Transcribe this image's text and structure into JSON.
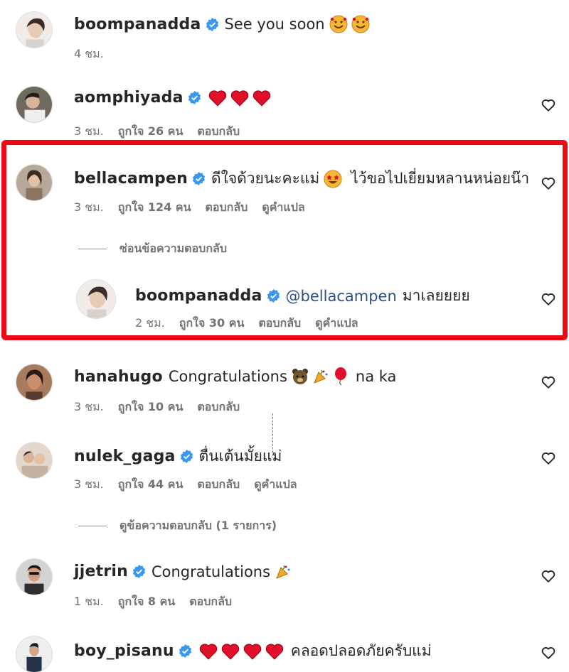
{
  "colors": {
    "highlight": "#ee0a14",
    "verified": "#3897f0",
    "heart_emoji": "#e0102a",
    "meta": "#737373",
    "mention": "#2b4f91"
  },
  "comments": [
    {
      "username": "boompanadda",
      "verified": true,
      "text": "See you soon",
      "emojis": [
        "smiling-face-with-hearts",
        "smiling-face-with-hearts"
      ],
      "time": "4 ชม.",
      "likes": "",
      "reply": "",
      "translate": "",
      "has_heart": false
    },
    {
      "username": "aomphiyada",
      "verified": true,
      "text": "",
      "emojis": [
        "red-heart",
        "red-heart",
        "red-heart"
      ],
      "time": "3 ชม.",
      "likes": "ถูกใจ 26 คน",
      "reply": "ตอบกลับ",
      "translate": "",
      "has_heart": true
    },
    {
      "username": "bellacampen",
      "verified": true,
      "text_before": "ดีใจด้วยนะคะแม่",
      "emojis": [
        "star-struck"
      ],
      "text_after": "ไว้ขอไปเยี่ยมหลานหน่อยน๊า",
      "time": "3 ชม.",
      "likes": "ถูกใจ 124 คน",
      "reply": "ตอบกลับ",
      "translate": "ดูคำแปล",
      "has_heart": true
    },
    {
      "username": "boompanadda",
      "verified": true,
      "mention": "@bellacampen",
      "text": "มาเลยยยย",
      "time": "2 ชม.",
      "likes": "ถูกใจ 30 คน",
      "reply": "ตอบกลับ",
      "translate": "ดูคำแปล",
      "has_heart": true
    },
    {
      "username": "hanahugo",
      "verified": false,
      "text": "Congratulations",
      "emojis": [
        "bear-face",
        "party-popper",
        "balloon"
      ],
      "text_after": "na ka",
      "time": "3 ชม.",
      "likes": "ถูกใจ 10 คน",
      "reply": "ตอบกลับ",
      "translate": "",
      "has_heart": true
    },
    {
      "username": "nulek_gaga",
      "verified": true,
      "text": "ตื่นเต้นมั้ยแม่",
      "time": "3 ชม.",
      "likes": "ถูกใจ 44 คน",
      "reply": "ตอบกลับ",
      "translate": "ดูคำแปล",
      "has_heart": true
    },
    {
      "username": "jjetrin",
      "verified": true,
      "text": "Congratulations",
      "emojis": [
        "party-popper"
      ],
      "time": "1 ชม.",
      "likes": "ถูกใจ 8 คน",
      "reply": "ตอบกลับ",
      "translate": "",
      "has_heart": true
    },
    {
      "username": "boy_pisanu",
      "verified": true,
      "text": "",
      "emojis": [
        "red-heart",
        "red-heart",
        "red-heart",
        "red-heart"
      ],
      "text_after": "คลอดปลอดภัยครับแม่",
      "time": "",
      "likes": "",
      "reply": "",
      "translate": "",
      "has_heart": true
    }
  ],
  "hide_replies": "ซ่อนข้อความตอบกลับ",
  "view_replies": "ดูข้อความตอบกลับ (1 รายการ)"
}
